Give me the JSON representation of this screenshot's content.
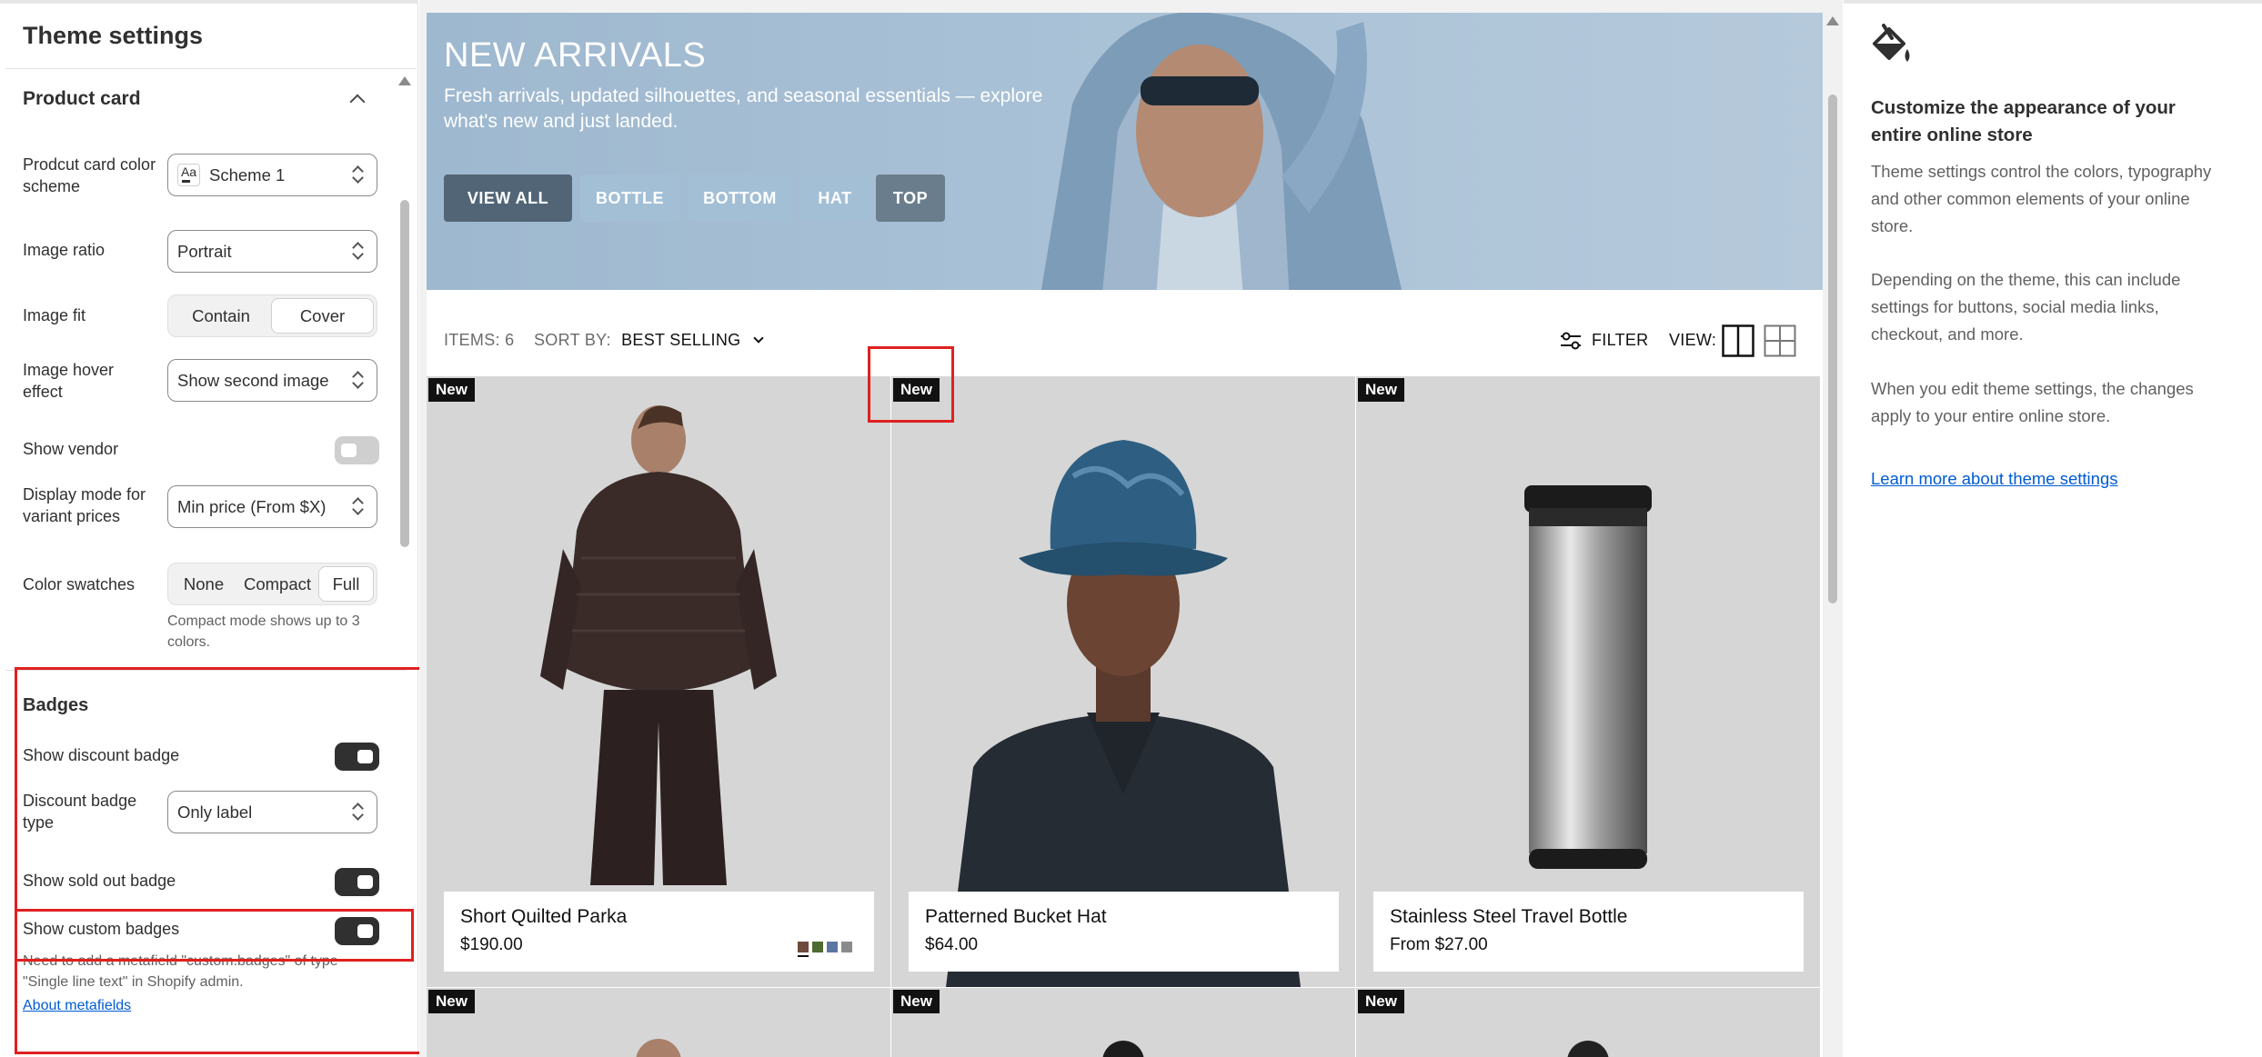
{
  "left_panel": {
    "title": "Theme settings",
    "product_card": {
      "section_title": "Product card",
      "color_scheme": {
        "label": "Prodcut card color scheme",
        "value": "Scheme 1",
        "icon_text": "Aa"
      },
      "image_ratio": {
        "label": "Image ratio",
        "value": "Portrait"
      },
      "image_fit": {
        "label": "Image fit",
        "options": [
          "Contain",
          "Cover"
        ],
        "selected": "Cover"
      },
      "image_hover": {
        "label": "Image hover effect",
        "value": "Show second image"
      },
      "show_vendor": {
        "label": "Show vendor",
        "on": false
      },
      "display_mode": {
        "label": "Display mode for variant prices",
        "value": "Min price (From $X)"
      },
      "color_swatches": {
        "label": "Color swatches",
        "options": [
          "None",
          "Compact",
          "Full"
        ],
        "selected": "Full",
        "help": "Compact mode shows up to 3 colors."
      }
    },
    "badges": {
      "section_title": "Badges",
      "show_discount": {
        "label": "Show discount badge",
        "on": true
      },
      "discount_type": {
        "label": "Discount badge type",
        "value": "Only label"
      },
      "show_sold_out": {
        "label": "Show sold out badge",
        "on": true
      },
      "show_custom": {
        "label": "Show custom badges",
        "on": true
      },
      "custom_help": "Need to add a metafield \"custom.badges\" of type \"Single line text\" in Shopify admin.",
      "custom_link": "About metafields"
    }
  },
  "preview": {
    "hero": {
      "title": "NEW ARRIVALS",
      "subtitle": "Fresh arrivals, updated silhouettes, and seasonal essentials — explore what's new and just landed.",
      "buttons": [
        "VIEW ALL",
        "BOTTLE",
        "BOTTOM",
        "HAT",
        "TOP"
      ]
    },
    "toolbar": {
      "items_label": "ITEMS:",
      "items_count": "6",
      "sort_label": "SORT BY:",
      "sort_value": "BEST SELLING",
      "filter_label": "FILTER",
      "view_label": "VIEW:"
    },
    "products": [
      {
        "badge": "New",
        "name": "Short Quilted Parka",
        "price": "$190.00",
        "swatches": [
          "#6e4a3c",
          "#4f6b2f",
          "#5b76a3",
          "#8b8b8b"
        ]
      },
      {
        "badge": "New",
        "name": "Patterned Bucket Hat",
        "price": "$64.00"
      },
      {
        "badge": "New",
        "name": "Stainless Steel Travel Bottle",
        "price": "From $27.00"
      },
      {
        "badge": "New"
      },
      {
        "badge": "New"
      },
      {
        "badge": "New"
      }
    ]
  },
  "right_panel": {
    "icon": "paint-bucket-icon",
    "title": "Customize the appearance of your entire online store",
    "paragraphs": [
      "Theme settings control the colors, typography and other common elements of your online store.",
      "Depending on the theme, this can include settings for buttons, social media links, checkout, and more.",
      "When you edit theme settings, the changes apply to your entire online store."
    ],
    "link": "Learn more about theme settings"
  },
  "colors": {
    "accent_red": "#e02020",
    "link_blue": "#005bd3",
    "toggle_on": "#303030"
  }
}
